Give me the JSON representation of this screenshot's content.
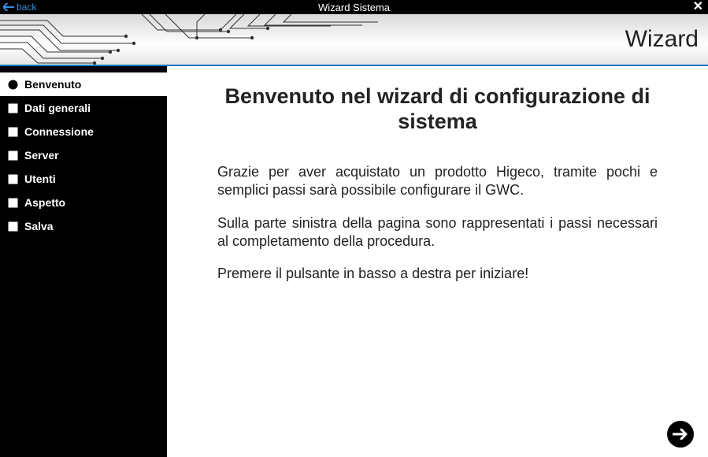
{
  "titlebar": {
    "back_label": "back",
    "title": "Wizard Sistema",
    "close_glyph": "✕"
  },
  "banner": {
    "title": "Wizard"
  },
  "sidebar": {
    "items": [
      {
        "label": "Benvenuto",
        "active": true
      },
      {
        "label": "Dati generali",
        "active": false
      },
      {
        "label": "Connessione",
        "active": false
      },
      {
        "label": "Server",
        "active": false
      },
      {
        "label": "Utenti",
        "active": false
      },
      {
        "label": "Aspetto",
        "active": false
      },
      {
        "label": "Salva",
        "active": false
      }
    ]
  },
  "main": {
    "heading": "Benvenuto nel wizard di configurazione di sistema",
    "paragraphs": [
      "Grazie per aver acquistato un prodotto Higeco, tramite pochi e semplici passi sarà possibile configurare il GWC.",
      "Sulla parte sinistra della pagina sono rappresentati i passi necessari al completamento della procedura.",
      "Premere il pulsante in basso a destra per iniziare!"
    ]
  }
}
